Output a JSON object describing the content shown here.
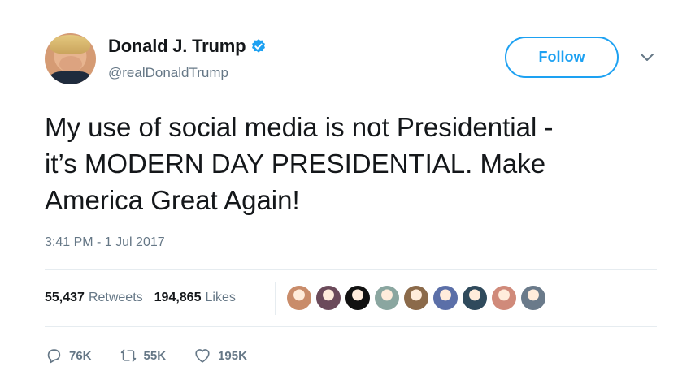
{
  "author": {
    "display_name": "Donald J. Trump",
    "handle": "@realDonaldTrump",
    "verified": true,
    "avatar_icon": "profile-photo"
  },
  "header": {
    "follow_label": "Follow",
    "menu_icon": "chevron-down-icon"
  },
  "tweet": {
    "text": "My use of social media is not Presidential -\nit’s MODERN DAY PRESIDENTIAL. Make\nAmerica Great Again!",
    "timestamp": "3:41 PM - 1 Jul 2017"
  },
  "stats": {
    "retweets_count": "55,437",
    "retweets_label": "Retweets",
    "likes_count": "194,865",
    "likes_label": "Likes",
    "liker_avatar_colors": [
      "#c98c6a",
      "#6b4a5a",
      "#111111",
      "#8aa6a0",
      "#8b6a4a",
      "#5b6fa8",
      "#2f4a5c",
      "#d08a7a",
      "#6a7a8a"
    ]
  },
  "actions": {
    "reply_count": "76K",
    "retweet_count": "55K",
    "like_count": "195K"
  },
  "colors": {
    "accent": "#1da1f2",
    "text": "#14171a",
    "muted": "#657786"
  }
}
